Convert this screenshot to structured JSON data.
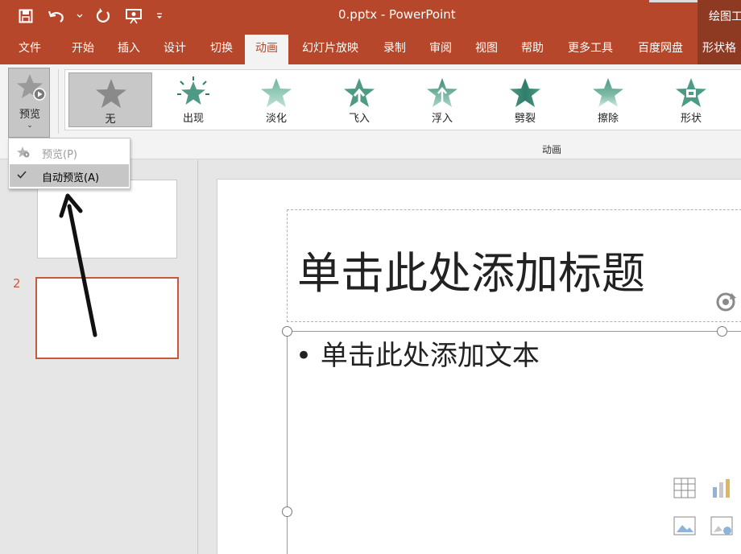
{
  "app": {
    "doc_title": "0.pptx  -  PowerPoint",
    "context_group": "绘图工"
  },
  "quick_access": {
    "icons": [
      "save-icon",
      "undo-icon",
      "undo-dropdown-icon",
      "redo-icon",
      "present-from-start-icon",
      "customize-qat-icon"
    ]
  },
  "tabs": [
    {
      "label": "文件"
    },
    {
      "label": "开始"
    },
    {
      "label": "插入"
    },
    {
      "label": "设计"
    },
    {
      "label": "切换"
    },
    {
      "label": "动画"
    },
    {
      "label": "幻灯片放映"
    },
    {
      "label": "录制"
    },
    {
      "label": "审阅"
    },
    {
      "label": "视图"
    },
    {
      "label": "帮助"
    },
    {
      "label": "更多工具"
    },
    {
      "label": "百度网盘"
    },
    {
      "label": "形状格"
    }
  ],
  "active_tab": "动画",
  "ribbon": {
    "preview_label": "预览",
    "group_label": "动画",
    "effects": [
      {
        "label": "无",
        "icon": "star-gray-icon"
      },
      {
        "label": "出现",
        "icon": "star-burst-icon"
      },
      {
        "label": "淡化",
        "icon": "star-fade-icon"
      },
      {
        "label": "飞入",
        "icon": "star-fly-in-icon"
      },
      {
        "label": "浮入",
        "icon": "star-float-in-icon"
      },
      {
        "label": "劈裂",
        "icon": "star-split-icon"
      },
      {
        "label": "擦除",
        "icon": "star-wipe-icon"
      },
      {
        "label": "形状",
        "icon": "star-shape-icon"
      }
    ]
  },
  "preview_menu": {
    "items": [
      {
        "label": "预览(P)",
        "state": "disabled"
      },
      {
        "label": "自动预览(A)",
        "state": "checked"
      }
    ]
  },
  "thumbnails": {
    "slide2_number": "2"
  },
  "slide": {
    "title_placeholder": "单击此处添加标题",
    "body_placeholder": "• 单击此处添加文本"
  },
  "colors": {
    "accent": "#b7472a",
    "context_tab": "#8e3a23",
    "selection": "#c55a3a",
    "star_green": "#4e9a85"
  }
}
